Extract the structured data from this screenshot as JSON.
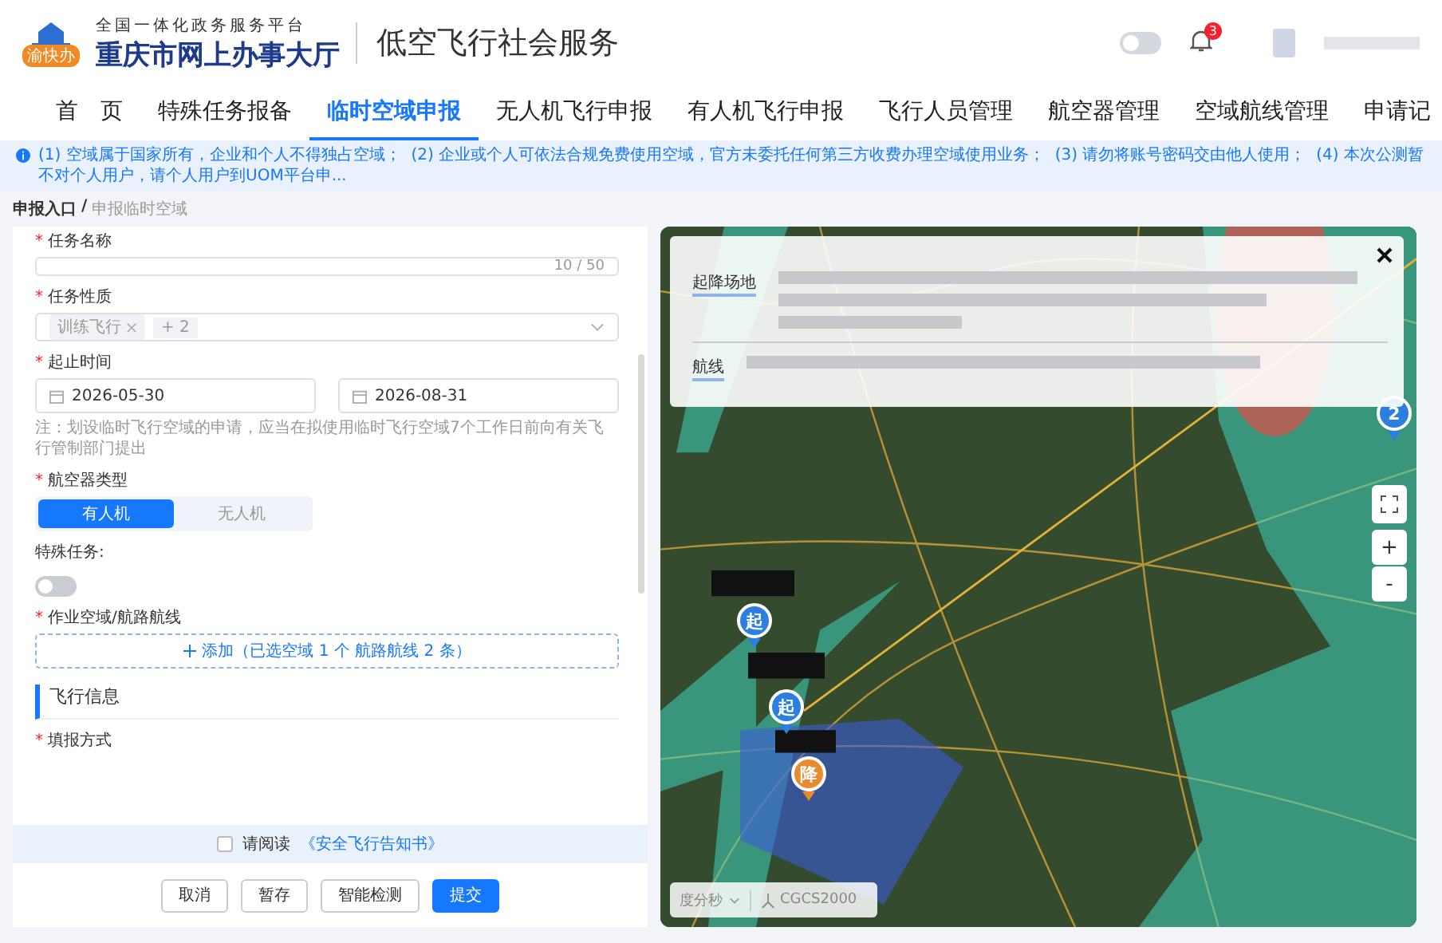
{
  "header": {
    "platform": "全国一体化政务服务平台",
    "site": "重庆市网上办事大厅",
    "logo_badge": "渝快办",
    "service": "低空飞行社会服务",
    "theme_switch_on": false,
    "notifications": "3"
  },
  "nav": {
    "tabs": [
      {
        "label": "首　页",
        "selected": false
      },
      {
        "label": "特殊任务报备",
        "selected": false
      },
      {
        "label": "临时空域申报",
        "selected": true
      },
      {
        "label": "无人机飞行申报",
        "selected": false
      },
      {
        "label": "有人机飞行申报",
        "selected": false
      },
      {
        "label": "飞行人员管理",
        "selected": false
      },
      {
        "label": "航空器管理",
        "selected": false
      },
      {
        "label": "空域航线管理",
        "selected": false
      },
      {
        "label": "申请记",
        "selected": false
      }
    ]
  },
  "notice": "(1) 空域属于国家所有，企业和个人不得独占空域；  (2) 企业或个人可依法合规免费使用空域，官方未委托任何第三方收费办理空域使用业务；  (3) 请勿将账号密码交由他人使用；  (4) 本次公测暂不对个人用户，请个人用户到UOM平台申...",
  "breadcrumb": {
    "items": [
      "申报入口",
      "申报临时空域"
    ],
    "separator": "/"
  },
  "required_mark": "*",
  "form": [
    {
      "kind": "text",
      "label": "任务名称",
      "required": true,
      "counter": "10 / 50"
    },
    {
      "kind": "tags",
      "label": "任务性质",
      "required": true,
      "tags": [
        "训练飞行"
      ],
      "more": "+ 2"
    },
    {
      "kind": "daterange",
      "label": "起止时间",
      "required": true,
      "start": "2026-05-30",
      "end": "2026-08-31",
      "note": "注：划设临时飞行空域的申请，应当在拟使用临时飞行空域7个工作日前向有关飞行管制部门提出"
    },
    {
      "kind": "segmented",
      "label": "航空器类型",
      "required": true,
      "options": [
        {
          "label": "有人机",
          "selected": true
        },
        {
          "label": "无人机",
          "selected": false
        }
      ]
    },
    {
      "kind": "switch",
      "label": "特殊任务:",
      "required": false,
      "on": false
    },
    {
      "kind": "add",
      "label": "作业空域/航路航线",
      "required": true,
      "button": "添加（已选空域 1 个  航路航线 2 条）"
    },
    {
      "kind": "section",
      "label": "飞行信息"
    },
    {
      "kind": "label",
      "label": "填报方式",
      "required": true
    }
  ],
  "agreement": {
    "checked": false,
    "text": "请阅读",
    "link": "《安全飞行告知书》"
  },
  "buttons": [
    {
      "label": "取消",
      "primary": false
    },
    {
      "label": "暂存",
      "primary": false
    },
    {
      "label": "智能检测",
      "primary": false
    },
    {
      "label": "提交",
      "primary": true
    }
  ],
  "map": {
    "popup": {
      "rows": [
        {
          "label": "起降场地"
        },
        {
          "label": "航线"
        }
      ]
    },
    "markers": [
      {
        "kind": "start",
        "label": "起"
      },
      {
        "kind": "start",
        "label": "起"
      },
      {
        "kind": "landing",
        "label": "降"
      },
      {
        "kind": "count",
        "label": "2"
      }
    ],
    "zoom_in": "+",
    "zoom_out": "-",
    "coord_format": "度分秒",
    "crs": "CGCS2000"
  }
}
